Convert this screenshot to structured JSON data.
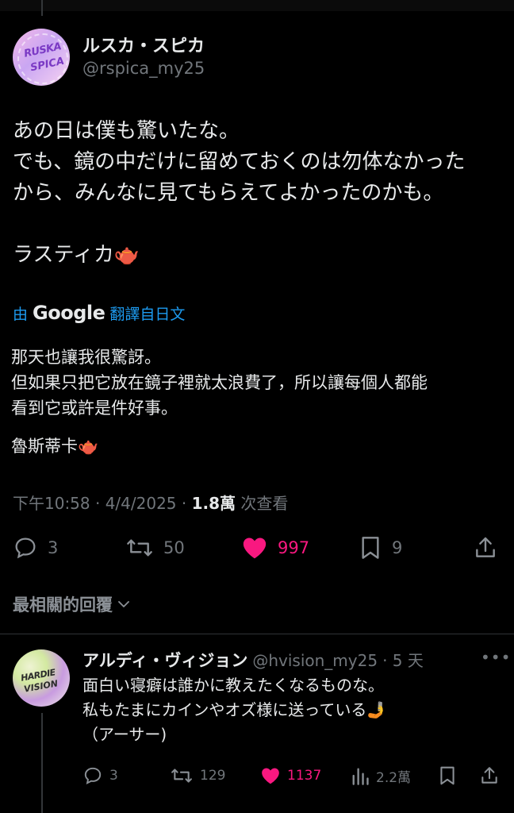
{
  "tweet": {
    "display_name": "ルスカ・スピカ",
    "handle": "@rspica_my25",
    "avatar_text_line1": "RUSKA",
    "avatar_text_line2": "SPICA",
    "text": "あの日は僕も驚いたな。\nでも、鏡の中だけに留めておくのは勿体なかった\nから、みんなに見てもらえてよかったのかも。\n\nラスティカ🫖",
    "translate_prefix": "由",
    "translate_brand": "Google",
    "translate_suffix": "翻譯自日文",
    "translated_text": "那天也讓我很驚訝。\n但如果只把它放在鏡子裡就太浪費了，所以讓每個人都能\n看到它或許是件好事。",
    "translated_signature": "魯斯蒂卡🫖",
    "time": "下午10:58 · 4/4/2025 · ",
    "views_count": "1.8萬",
    "views_label": " 次查看",
    "replies": "3",
    "retweets": "50",
    "likes": "997",
    "bookmarks": "9",
    "like_color": "#f91880"
  },
  "sort_label": "最相關的回覆",
  "reply": {
    "display_name": "アルディ・ヴィジョン",
    "handle": "@hvision_my25",
    "age": "· 5 天",
    "avatar_text_line1": "HARDIE",
    "avatar_text_line2": "VISION",
    "text": "面白い寝癖は誰かに教えたくなるものな。\n私もたまにカインやオズ様に送っている🤳\n（アーサー)",
    "replies": "3",
    "retweets": "129",
    "likes": "1137",
    "views": "2.2萬"
  }
}
